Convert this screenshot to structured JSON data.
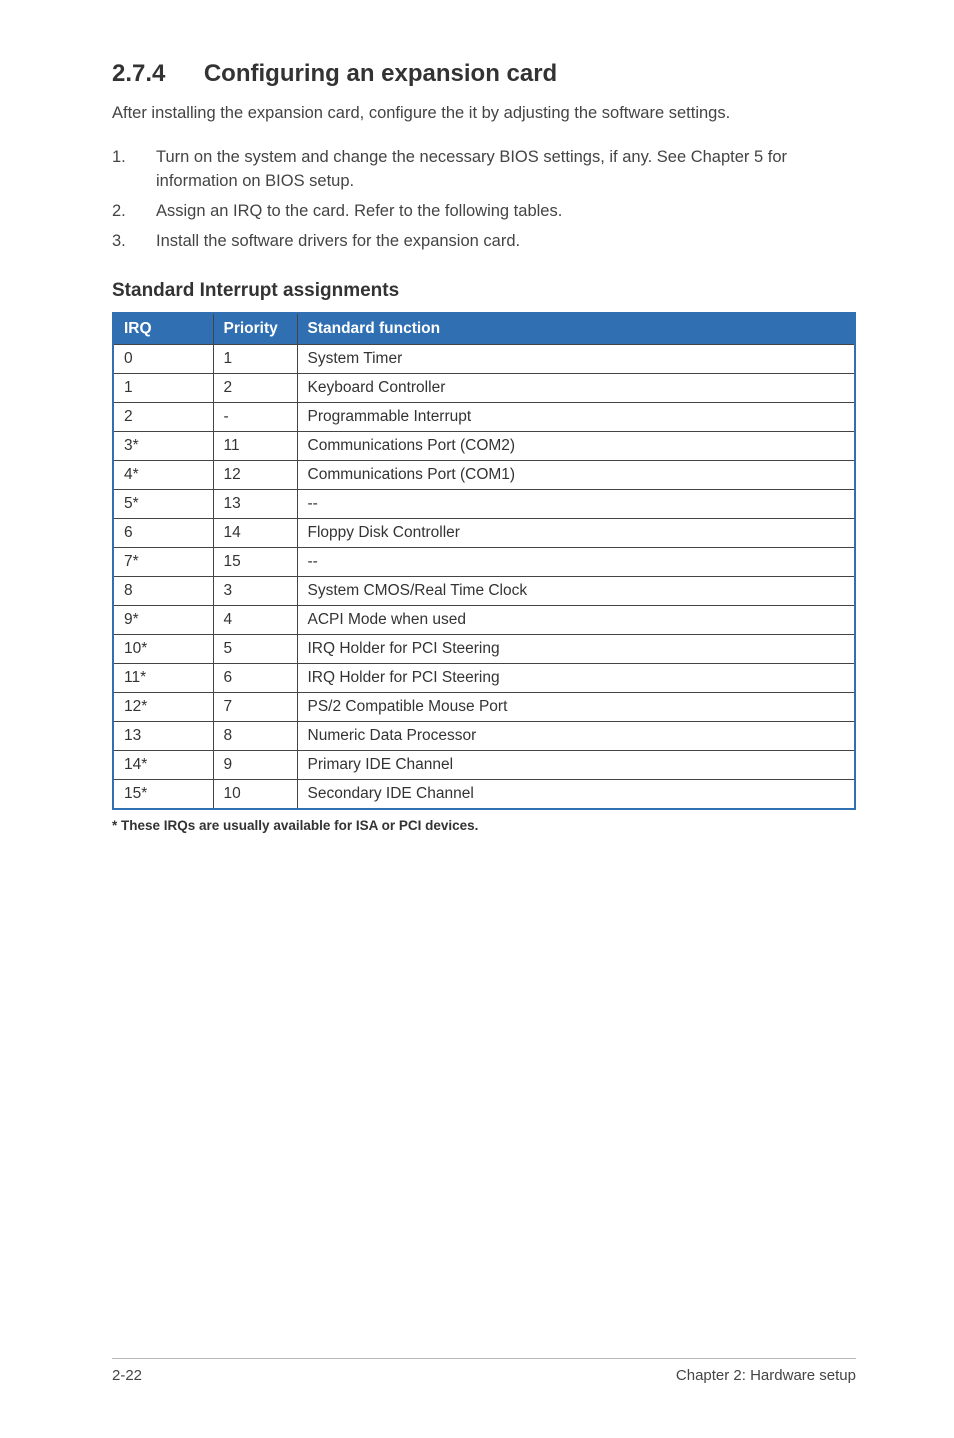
{
  "section": {
    "number": "2.7.4",
    "title": "Configuring an expansion card"
  },
  "intro": "After installing the expansion card, configure the it by adjusting the software settings.",
  "steps": [
    {
      "num": "1.",
      "text": "Turn on the system and change the necessary BIOS settings, if any. See Chapter 5 for information on BIOS setup."
    },
    {
      "num": "2.",
      "text": "Assign an IRQ to the card. Refer to the following tables."
    },
    {
      "num": "3.",
      "text": "Install the software drivers for the expansion card."
    }
  ],
  "table": {
    "heading": "Standard Interrupt assignments",
    "columns": {
      "irq": "IRQ",
      "priority": "Priority",
      "func": "Standard function"
    },
    "rows": [
      {
        "irq": "0",
        "priority": "1",
        "func": "System Timer"
      },
      {
        "irq": "1",
        "priority": "2",
        "func": "Keyboard Controller"
      },
      {
        "irq": "2",
        "priority": "-",
        "func": "Programmable Interrupt"
      },
      {
        "irq": "3*",
        "priority": "11",
        "func": "Communications Port (COM2)"
      },
      {
        "irq": "4*",
        "priority": "12",
        "func": "Communications Port (COM1)"
      },
      {
        "irq": "5*",
        "priority": "13",
        "func": "--"
      },
      {
        "irq": "6",
        "priority": "14",
        "func": "Floppy Disk Controller"
      },
      {
        "irq": "7*",
        "priority": "15",
        "func": "--"
      },
      {
        "irq": "8",
        "priority": "3",
        "func": "System CMOS/Real Time Clock"
      },
      {
        "irq": "9*",
        "priority": "4",
        "func": "ACPI Mode when used"
      },
      {
        "irq": "10*",
        "priority": "5",
        "func": "IRQ Holder for PCI Steering"
      },
      {
        "irq": "11*",
        "priority": "6",
        "func": "IRQ Holder for PCI Steering"
      },
      {
        "irq": "12*",
        "priority": "7",
        "func": "PS/2 Compatible Mouse Port"
      },
      {
        "irq": "13",
        "priority": "8",
        "func": "Numeric Data Processor"
      },
      {
        "irq": "14*",
        "priority": "9",
        "func": "Primary IDE Channel"
      },
      {
        "irq": "15*",
        "priority": "10",
        "func": "Secondary IDE Channel"
      }
    ],
    "footnote": "* These IRQs are usually available for ISA or PCI devices."
  },
  "footer": {
    "left": "2-22",
    "right": "Chapter 2:  Hardware setup"
  }
}
